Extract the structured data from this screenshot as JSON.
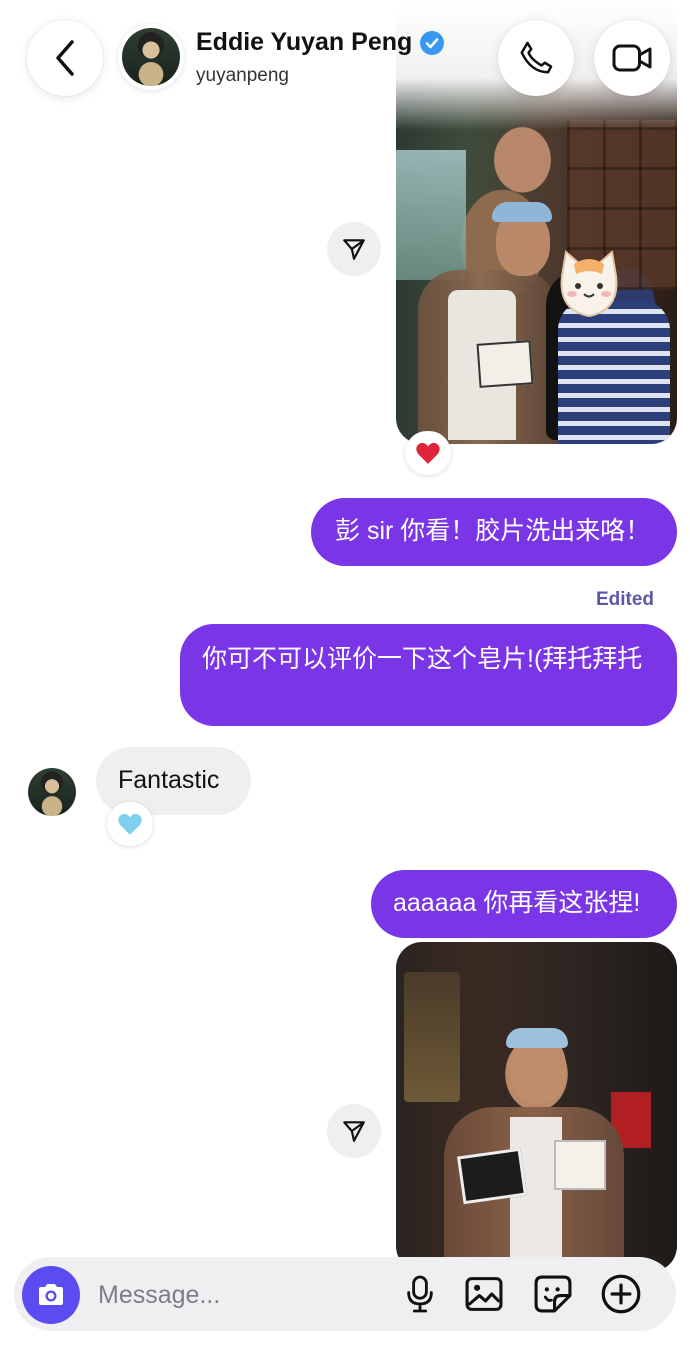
{
  "header": {
    "name": "Eddie Yuyan Peng",
    "handle": "yuyanpeng",
    "verified": true
  },
  "messages": [
    {
      "type": "image",
      "direction": "outgoing",
      "reaction": "red-heart-icon",
      "has_sticker": "cat-face-sticker"
    },
    {
      "type": "text",
      "direction": "outgoing",
      "text": "彭 sir 你看！胶片洗出来咯！"
    },
    {
      "type": "text",
      "direction": "outgoing",
      "status": "Edited",
      "text": "你可不可以评价一下这个皂片!(拜托拜托"
    },
    {
      "type": "text",
      "direction": "incoming",
      "text": "Fantastic",
      "reaction": "light-blue-heart-icon"
    },
    {
      "type": "text",
      "direction": "outgoing",
      "text": "aaaaaa 你再看这张捏!"
    },
    {
      "type": "image",
      "direction": "outgoing"
    }
  ],
  "composer": {
    "placeholder": "Message..."
  },
  "colors": {
    "outgoing_bubble": "#7a35e6",
    "incoming_bubble": "#efeff1",
    "camera_button": "#5a4cf0",
    "edited_label": "#5c58a8",
    "verified_badge": "#3897f0"
  }
}
